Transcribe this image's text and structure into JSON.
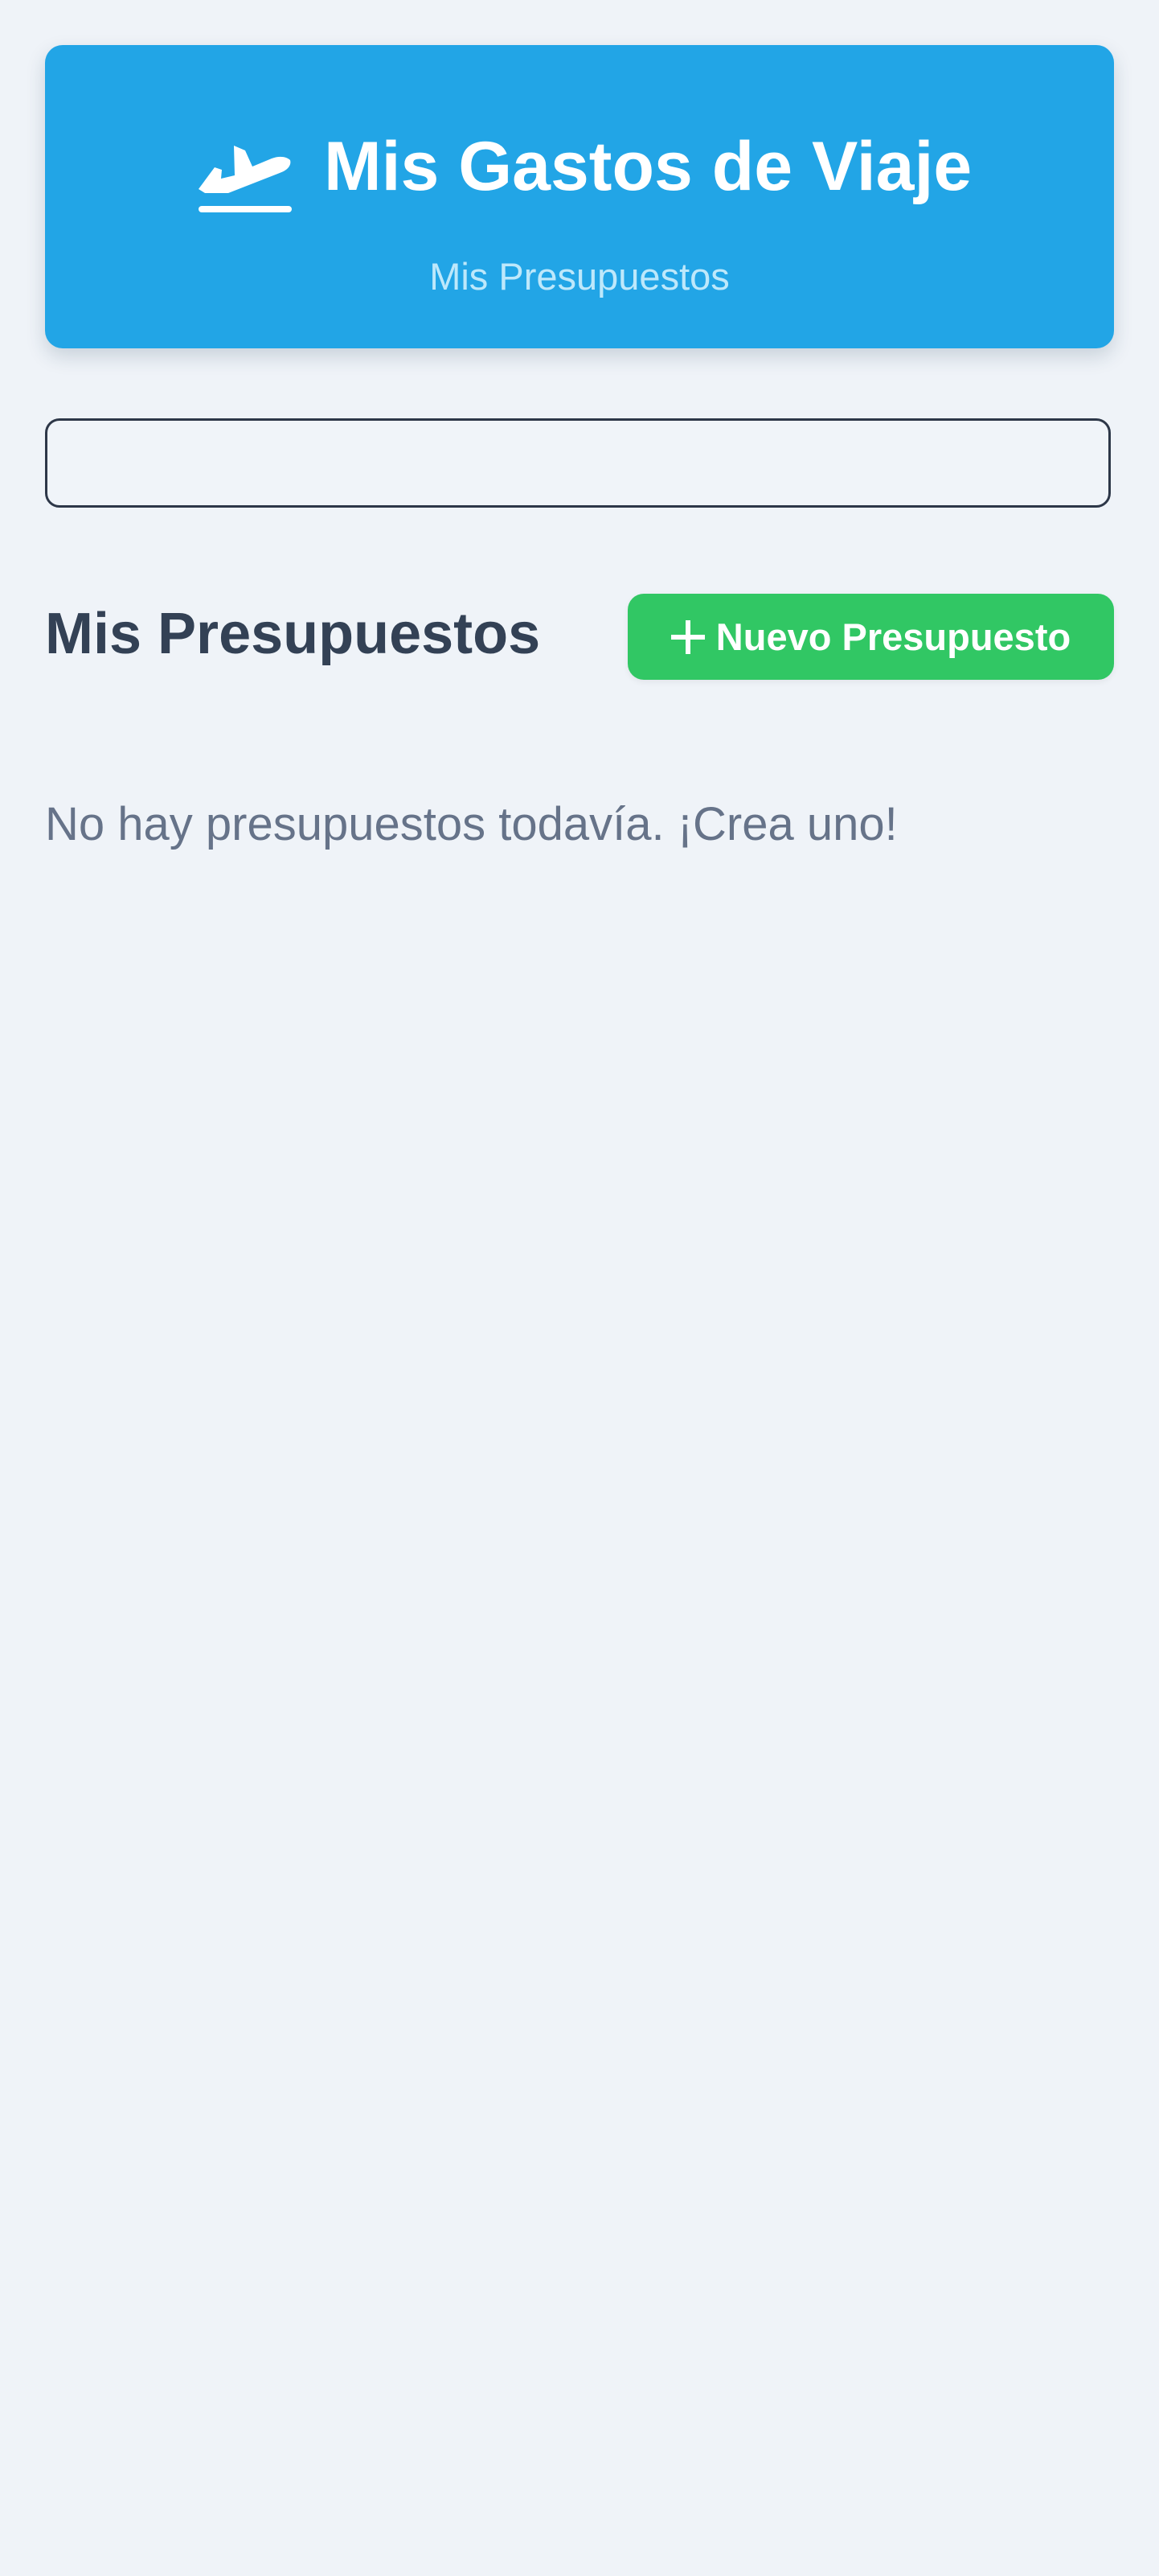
{
  "header": {
    "icon": "plane-departure-icon",
    "title": "Mis Gastos de Viaje",
    "subtitle": "Mis Presupuestos",
    "background_color": "#22a5e6"
  },
  "search": {
    "value": "",
    "placeholder": ""
  },
  "budgets_section": {
    "title": "Mis Presupuestos",
    "new_button": {
      "icon": "plus-icon",
      "label": "Nuevo Presupuesto",
      "color": "#31c764"
    },
    "empty_message": "No hay presupuestos todavía. ¡Crea uno!"
  }
}
